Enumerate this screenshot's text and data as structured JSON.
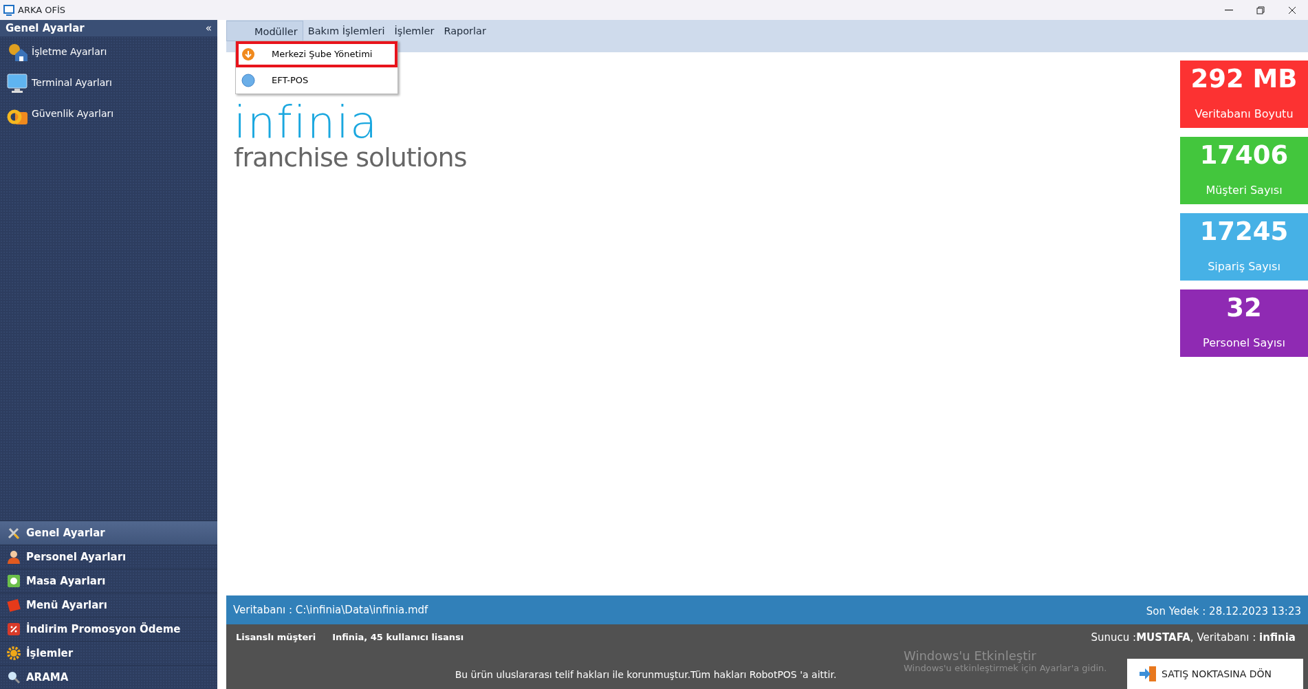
{
  "window": {
    "title": "ARKA OFİS"
  },
  "sidebar": {
    "title": "Genel Ayarlar",
    "collapse_glyph": "«",
    "items": [
      {
        "label": "İşletme Ayarları"
      },
      {
        "label": "Terminal Ayarları"
      },
      {
        "label": "Güvenlik Ayarları"
      }
    ]
  },
  "nav_sections": [
    {
      "label": "Genel Ayarlar",
      "selected": true
    },
    {
      "label": "Personel Ayarları",
      "selected": false
    },
    {
      "label": "Masa Ayarları",
      "selected": false
    },
    {
      "label": "Menü Ayarları",
      "selected": false
    },
    {
      "label": "İndirim Promosyon Ödeme",
      "selected": false
    },
    {
      "label": "İşlemler",
      "selected": false
    },
    {
      "label": "ARAMA",
      "selected": false
    }
  ],
  "menu_bar": {
    "tabs": [
      {
        "label": "Modüller",
        "selected": true
      },
      {
        "label": "Bakım İşlemleri",
        "selected": false
      },
      {
        "label": "İşlemler",
        "selected": false
      },
      {
        "label": "Raporlar",
        "selected": false
      }
    ]
  },
  "dropdown": {
    "items": [
      {
        "label": "Merkezi Şube Yönetimi",
        "highlighted": true
      },
      {
        "label": "EFT-POS",
        "highlighted": false
      }
    ]
  },
  "logo": {
    "name": "infinia",
    "tagline": "franchise solutions"
  },
  "stats": [
    {
      "value": "292 MB",
      "label": "Veritabanı Boyutu",
      "color": "#fc3232"
    },
    {
      "value": "17406",
      "label": "Müşteri Sayısı",
      "color": "#43c63d"
    },
    {
      "value": "17245",
      "label": "Sipariş Sayısı",
      "color": "#46b1e6"
    },
    {
      "value": "32",
      "label": "Personel Sayısı",
      "color": "#8f2ab3"
    }
  ],
  "status_bar": {
    "database": "Veritabanı : C:\\infinia\\Data\\infinia.mdf",
    "last_backup": "Son Yedek : 28.12.2023 13:23"
  },
  "footer": {
    "license_label": "Lisanslı müşteri",
    "license": "Infinia, 45 kullanıcı lisansı",
    "server": "Sunucu :**MUSTAFA**, Veritabanı : **infinia**",
    "copyright": "Bu ürün uluslararası telif hakları ile korunmuştur.Tüm hakları RobotPOS 'a aittir.",
    "activation_title": "Windows'u Etkinleştir",
    "activation_hint": "Windows'u etkinleştirmek için Ayarlar'a gidin.",
    "return_button": "SATIŞ NOKTASINA DÖN"
  }
}
